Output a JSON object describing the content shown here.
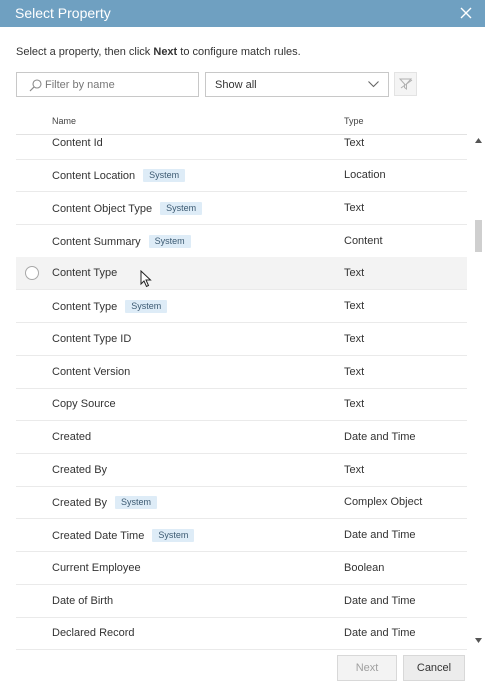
{
  "dialog": {
    "title": "Select Property",
    "intro_before": "Select a property, then click ",
    "intro_bold": "Next",
    "intro_after": " to configure match rules."
  },
  "filter": {
    "search_placeholder": "Filter by name",
    "search_value": "",
    "show_select_value": "Show all"
  },
  "columns": {
    "name": "Name",
    "type": "Type"
  },
  "rows": [
    {
      "name": "Content Id",
      "badge": "",
      "type": "Text"
    },
    {
      "name": "Content Location",
      "badge": "System",
      "type": "Location"
    },
    {
      "name": "Content Object Type",
      "badge": "System",
      "type": "Text"
    },
    {
      "name": "Content Summary",
      "badge": "System",
      "type": "Content"
    },
    {
      "name": "Content Type",
      "badge": "",
      "type": "Text"
    },
    {
      "name": "Content Type",
      "badge": "System",
      "type": "Text"
    },
    {
      "name": "Content Type ID",
      "badge": "",
      "type": "Text"
    },
    {
      "name": "Content Version",
      "badge": "",
      "type": "Text"
    },
    {
      "name": "Copy Source",
      "badge": "",
      "type": "Text"
    },
    {
      "name": "Created",
      "badge": "",
      "type": "Date and Time"
    },
    {
      "name": "Created By",
      "badge": "",
      "type": "Text"
    },
    {
      "name": "Created By",
      "badge": "System",
      "type": "Complex Object"
    },
    {
      "name": "Created Date Time",
      "badge": "System",
      "type": "Date and Time"
    },
    {
      "name": "Current Employee",
      "badge": "",
      "type": "Boolean"
    },
    {
      "name": "Date of Birth",
      "badge": "",
      "type": "Date and Time"
    },
    {
      "name": "Declared Record",
      "badge": "",
      "type": "Date and Time"
    }
  ],
  "hovered_row": 4,
  "footer": {
    "next_label": "Next",
    "cancel_label": "Cancel"
  },
  "colors": {
    "titlebar": "#6fa0c1",
    "badge_bg": "#deecf7",
    "hover_row": "#f3f3f3"
  },
  "icons": [
    "close-icon",
    "search-icon",
    "chevron-down-icon",
    "clear-filter-icon",
    "scroll-up-icon",
    "scroll-down-icon",
    "mouse-cursor-icon"
  ]
}
